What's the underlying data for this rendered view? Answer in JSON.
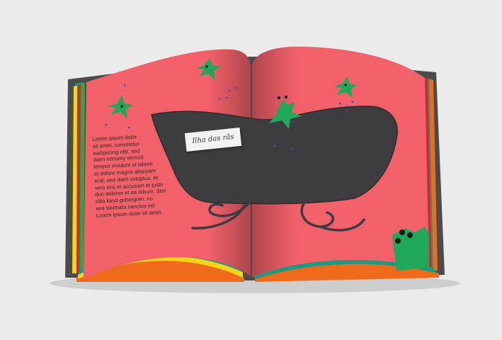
{
  "book": {
    "left_page": {
      "text_lines": [
        "Lorem ipsum dolor",
        "sit amet, consetetur",
        "sadipscing elitr, sed",
        "diam nonumy eirmod",
        "tempor invidunt ut labore",
        "et dolore magna aliquyam",
        "erat, sed diam voluptua. At",
        "vero eos et accusam et justo",
        "duo dolores et ea rebum. Stet",
        "clita kasd gubergren, no",
        "sea takimata sanctus est",
        "Lorem ipsum dolor sit amet."
      ]
    },
    "right_page": {
      "label": "Ilha das rãs"
    },
    "colors": {
      "page": "#f2606a",
      "island": "#3d3d3f",
      "frog": "#1fa85a",
      "cover": "#4b4b4b",
      "stripe_teal": "#199c84",
      "stripe_yellow": "#f5d516",
      "stripe_orange": "#f06a1c",
      "stripe_red": "#d8262f",
      "stripe_green": "#3aa33a",
      "background": "#ebebeb"
    },
    "icons": [
      "frog-icon",
      "sparkle-icon",
      "water-drop-icon",
      "island-blob",
      "swirl-icon"
    ]
  }
}
